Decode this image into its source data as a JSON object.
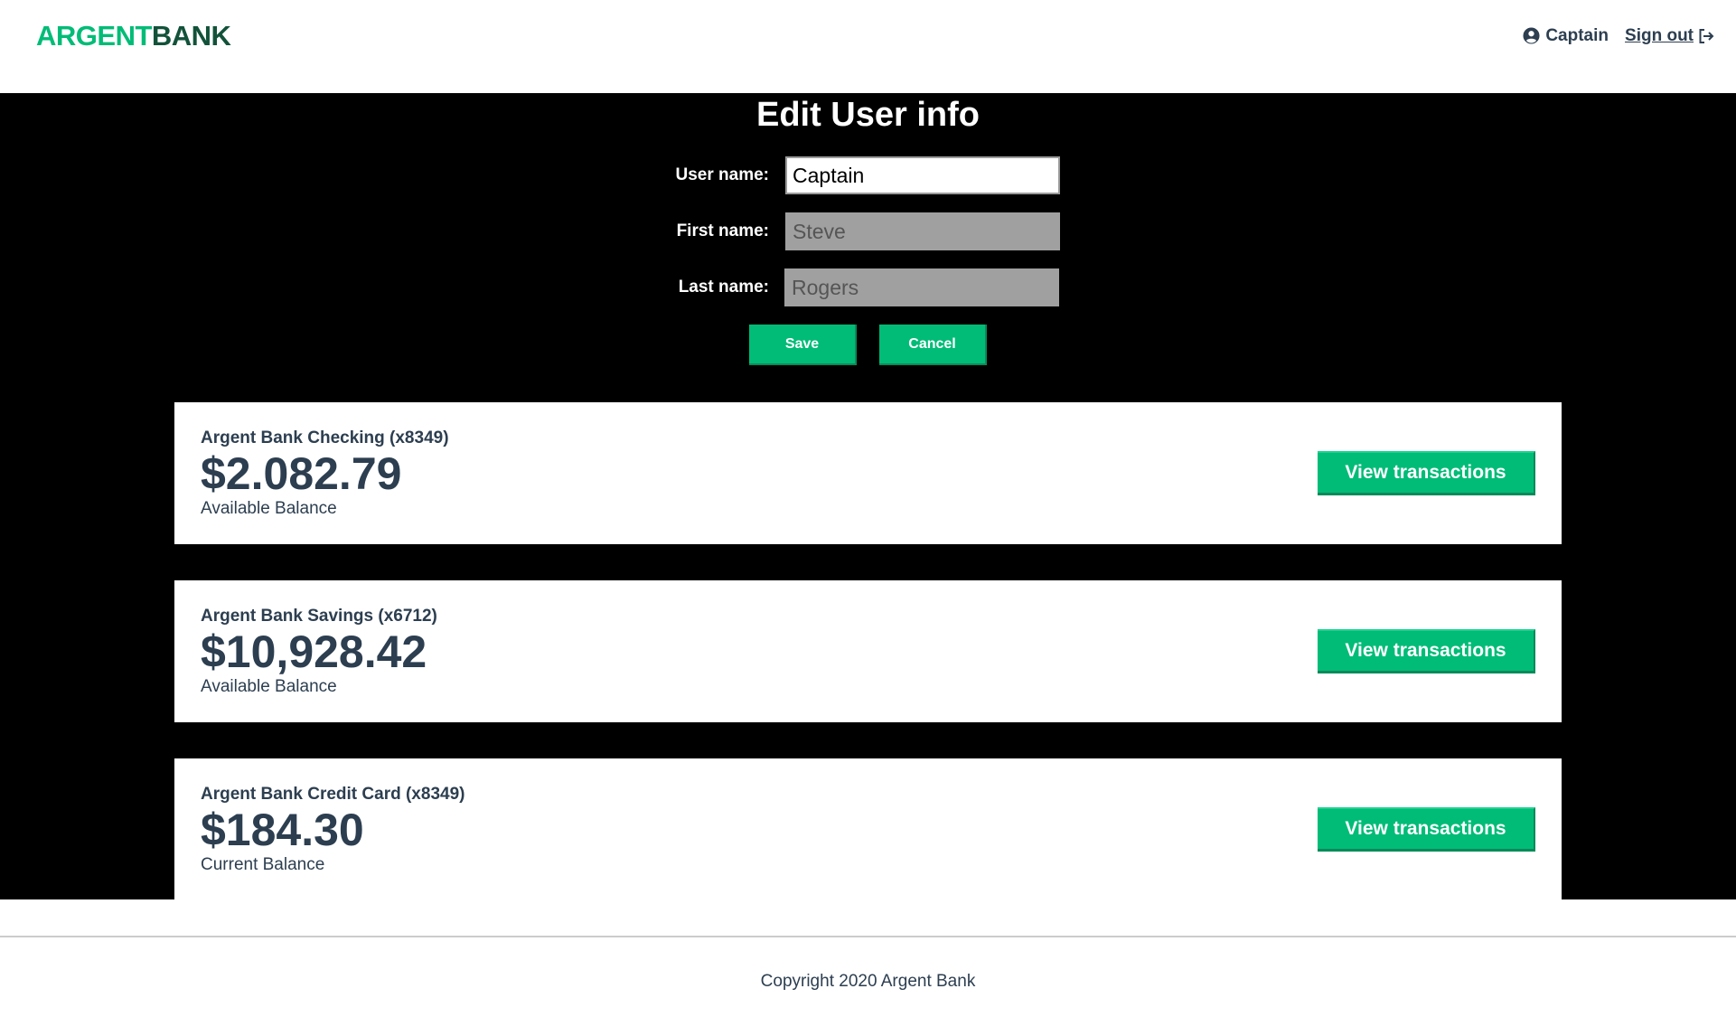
{
  "header": {
    "logo_part1": "ARGENT",
    "logo_part2": "BANK",
    "user_name": "Captain",
    "signout_label": "Sign out",
    "brand_color": "#00bc77",
    "brand_dark": "#12523a"
  },
  "edit": {
    "title": "Edit User info",
    "username_label": "User name:",
    "username_value": "Captain",
    "firstname_label": "First name:",
    "firstname_value": "Steve",
    "lastname_label": "Last name:",
    "lastname_value": "Rogers",
    "save_label": "Save",
    "cancel_label": "Cancel"
  },
  "accounts": [
    {
      "title": "Argent Bank Checking (x8349)",
      "amount": "$2.082.79",
      "description": "Available Balance",
      "button": "View transactions"
    },
    {
      "title": "Argent Bank Savings (x6712)",
      "amount": "$10,928.42",
      "description": "Available Balance",
      "button": "View transactions"
    },
    {
      "title": "Argent Bank Credit Card (x8349)",
      "amount": "$184.30",
      "description": "Current Balance",
      "button": "View transactions"
    }
  ],
  "footer": {
    "copyright": "Copyright 2020 Argent Bank"
  }
}
